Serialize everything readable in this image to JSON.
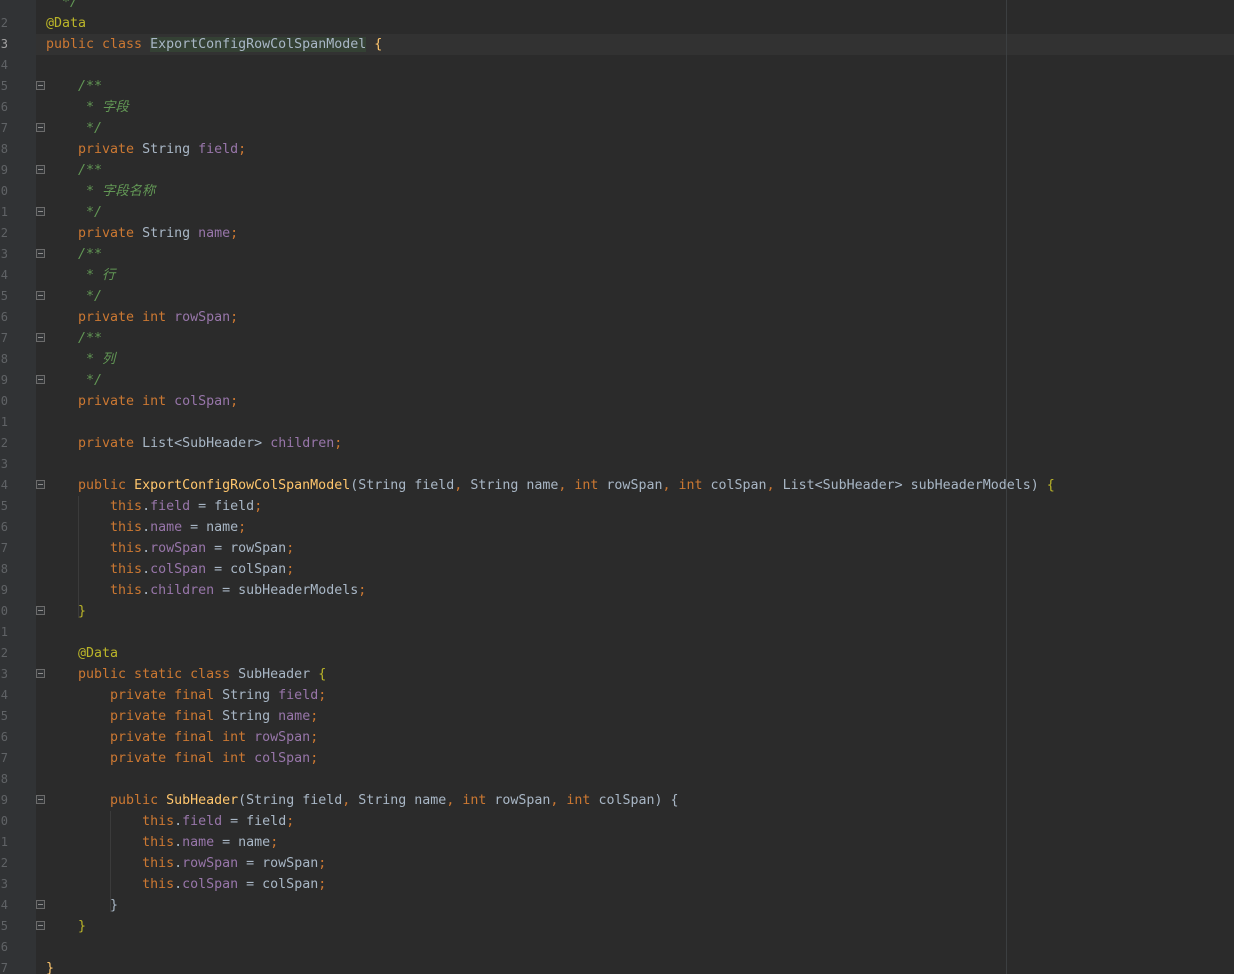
{
  "editor": {
    "lines": [
      {
        "n": "",
        "tokens": [
          [
            "cm",
            "  */"
          ]
        ]
      },
      {
        "n": "2",
        "tokens": [
          [
            "an",
            "@Data"
          ]
        ]
      },
      {
        "n": "3",
        "current": true,
        "tokens": [
          [
            "kw",
            "public class "
          ],
          [
            "hl",
            "ExportConfigRowColSpanModel"
          ],
          [
            "pl",
            " "
          ],
          [
            "fn",
            "{"
          ]
        ]
      },
      {
        "n": "4",
        "tokens": []
      },
      {
        "n": "5",
        "fold": true,
        "tokens": [
          [
            "cm",
            "    /**"
          ]
        ]
      },
      {
        "n": "6",
        "tokens": [
          [
            "cm",
            "     * 字段"
          ]
        ]
      },
      {
        "n": "7",
        "fold": true,
        "tokens": [
          [
            "cm",
            "     */"
          ]
        ]
      },
      {
        "n": "8",
        "tokens": [
          [
            "kw",
            "    private "
          ],
          [
            "cls",
            "String "
          ],
          [
            "fd",
            "field"
          ],
          [
            "pn",
            ";"
          ]
        ]
      },
      {
        "n": "9",
        "fold": true,
        "tokens": [
          [
            "cm",
            "    /**"
          ]
        ]
      },
      {
        "n": "0",
        "tokens": [
          [
            "cm",
            "     * 字段名称"
          ]
        ]
      },
      {
        "n": "1",
        "fold": true,
        "tokens": [
          [
            "cm",
            "     */"
          ]
        ]
      },
      {
        "n": "2",
        "tokens": [
          [
            "kw",
            "    private "
          ],
          [
            "cls",
            "String "
          ],
          [
            "fd",
            "name"
          ],
          [
            "pn",
            ";"
          ]
        ]
      },
      {
        "n": "3",
        "fold": true,
        "tokens": [
          [
            "cm",
            "    /**"
          ]
        ]
      },
      {
        "n": "4",
        "tokens": [
          [
            "cm",
            "     * 行"
          ]
        ]
      },
      {
        "n": "5",
        "fold": true,
        "tokens": [
          [
            "cm",
            "     */"
          ]
        ]
      },
      {
        "n": "6",
        "tokens": [
          [
            "kw",
            "    private int "
          ],
          [
            "fd",
            "rowSpan"
          ],
          [
            "pn",
            ";"
          ]
        ]
      },
      {
        "n": "7",
        "fold": true,
        "tokens": [
          [
            "cm",
            "    /**"
          ]
        ]
      },
      {
        "n": "8",
        "tokens": [
          [
            "cm",
            "     * 列"
          ]
        ]
      },
      {
        "n": "9",
        "fold": true,
        "tokens": [
          [
            "cm",
            "     */"
          ]
        ]
      },
      {
        "n": "0",
        "tokens": [
          [
            "kw",
            "    private int "
          ],
          [
            "fd",
            "colSpan"
          ],
          [
            "pn",
            ";"
          ]
        ]
      },
      {
        "n": "1",
        "tokens": []
      },
      {
        "n": "2",
        "tokens": [
          [
            "kw",
            "    private "
          ],
          [
            "cls",
            "List"
          ],
          [
            "gen",
            "<SubHeader> "
          ],
          [
            "fd",
            "children"
          ],
          [
            "pn",
            ";"
          ]
        ]
      },
      {
        "n": "3",
        "tokens": []
      },
      {
        "n": "4",
        "fold": true,
        "tokens": [
          [
            "kw",
            "    public "
          ],
          [
            "fn",
            "ExportConfigRowColSpanModel"
          ],
          [
            "pl",
            "(String field"
          ],
          [
            "pn",
            ", "
          ],
          [
            "pl",
            "String name"
          ],
          [
            "pn",
            ", "
          ],
          [
            "kw",
            "int "
          ],
          [
            "pl",
            "rowSpan"
          ],
          [
            "pn",
            ", "
          ],
          [
            "kw",
            "int "
          ],
          [
            "pl",
            "colSpan"
          ],
          [
            "pn",
            ", "
          ],
          [
            "pl",
            "List<SubHeader> subHeaderModels) "
          ],
          [
            "an",
            "{"
          ]
        ]
      },
      {
        "n": "5",
        "tokens": [
          [
            "kw",
            "        this"
          ],
          [
            "pl",
            "."
          ],
          [
            "fd",
            "field "
          ],
          [
            "pl",
            "= field"
          ],
          [
            "pn",
            ";"
          ]
        ]
      },
      {
        "n": "6",
        "tokens": [
          [
            "kw",
            "        this"
          ],
          [
            "pl",
            "."
          ],
          [
            "fd",
            "name "
          ],
          [
            "pl",
            "= name"
          ],
          [
            "pn",
            ";"
          ]
        ]
      },
      {
        "n": "7",
        "tokens": [
          [
            "kw",
            "        this"
          ],
          [
            "pl",
            "."
          ],
          [
            "fd",
            "rowSpan "
          ],
          [
            "pl",
            "= rowSpan"
          ],
          [
            "pn",
            ";"
          ]
        ]
      },
      {
        "n": "8",
        "tokens": [
          [
            "kw",
            "        this"
          ],
          [
            "pl",
            "."
          ],
          [
            "fd",
            "colSpan "
          ],
          [
            "pl",
            "= colSpan"
          ],
          [
            "pn",
            ";"
          ]
        ]
      },
      {
        "n": "9",
        "tokens": [
          [
            "kw",
            "        this"
          ],
          [
            "pl",
            "."
          ],
          [
            "fd",
            "children "
          ],
          [
            "pl",
            "= subHeaderModels"
          ],
          [
            "pn",
            ";"
          ]
        ]
      },
      {
        "n": "0",
        "fold": true,
        "tokens": [
          [
            "an",
            "    }"
          ]
        ]
      },
      {
        "n": "1",
        "tokens": []
      },
      {
        "n": "2",
        "tokens": [
          [
            "an",
            "    @Data"
          ]
        ]
      },
      {
        "n": "3",
        "fold": true,
        "tokens": [
          [
            "kw",
            "    public static class "
          ],
          [
            "cls",
            "SubHeader "
          ],
          [
            "an",
            "{"
          ]
        ]
      },
      {
        "n": "4",
        "tokens": [
          [
            "kw",
            "        private final "
          ],
          [
            "cls",
            "String "
          ],
          [
            "fd",
            "field"
          ],
          [
            "pn",
            ";"
          ]
        ]
      },
      {
        "n": "5",
        "tokens": [
          [
            "kw",
            "        private final "
          ],
          [
            "cls",
            "String "
          ],
          [
            "fd",
            "name"
          ],
          [
            "pn",
            ";"
          ]
        ]
      },
      {
        "n": "6",
        "tokens": [
          [
            "kw",
            "        private final int "
          ],
          [
            "fd",
            "rowSpan"
          ],
          [
            "pn",
            ";"
          ]
        ]
      },
      {
        "n": "7",
        "tokens": [
          [
            "kw",
            "        private final int "
          ],
          [
            "fd",
            "colSpan"
          ],
          [
            "pn",
            ";"
          ]
        ]
      },
      {
        "n": "8",
        "tokens": []
      },
      {
        "n": "9",
        "fold": true,
        "tokens": [
          [
            "kw",
            "        public "
          ],
          [
            "fn",
            "SubHeader"
          ],
          [
            "pl",
            "(String field"
          ],
          [
            "pn",
            ", "
          ],
          [
            "pl",
            "String name"
          ],
          [
            "pn",
            ", "
          ],
          [
            "kw",
            "int "
          ],
          [
            "pl",
            "rowSpan"
          ],
          [
            "pn",
            ", "
          ],
          [
            "kw",
            "int "
          ],
          [
            "pl",
            "colSpan) "
          ],
          [
            "cls",
            "{"
          ]
        ]
      },
      {
        "n": "0",
        "tokens": [
          [
            "kw",
            "            this"
          ],
          [
            "pl",
            "."
          ],
          [
            "fd",
            "field "
          ],
          [
            "pl",
            "= field"
          ],
          [
            "pn",
            ";"
          ]
        ]
      },
      {
        "n": "1",
        "tokens": [
          [
            "kw",
            "            this"
          ],
          [
            "pl",
            "."
          ],
          [
            "fd",
            "name "
          ],
          [
            "pl",
            "= name"
          ],
          [
            "pn",
            ";"
          ]
        ]
      },
      {
        "n": "2",
        "tokens": [
          [
            "kw",
            "            this"
          ],
          [
            "pl",
            "."
          ],
          [
            "fd",
            "rowSpan "
          ],
          [
            "pl",
            "= rowSpan"
          ],
          [
            "pn",
            ";"
          ]
        ]
      },
      {
        "n": "3",
        "tokens": [
          [
            "kw",
            "            this"
          ],
          [
            "pl",
            "."
          ],
          [
            "fd",
            "colSpan "
          ],
          [
            "pl",
            "= colSpan"
          ],
          [
            "pn",
            ";"
          ]
        ]
      },
      {
        "n": "4",
        "fold": true,
        "tokens": [
          [
            "cls",
            "        }"
          ]
        ]
      },
      {
        "n": "5",
        "fold": true,
        "tokens": [
          [
            "an",
            "    }"
          ]
        ]
      },
      {
        "n": "6",
        "tokens": []
      },
      {
        "n": "7",
        "tokens": [
          [
            "fn",
            "}"
          ]
        ]
      }
    ]
  },
  "colors": {
    "background": "#2b2b2b",
    "gutter": "#313335",
    "keyword": "#cc7832",
    "annotation": "#bbb529",
    "comment": "#629755",
    "field": "#9876aa",
    "method": "#ffc66d",
    "text": "#a9b7c6"
  }
}
